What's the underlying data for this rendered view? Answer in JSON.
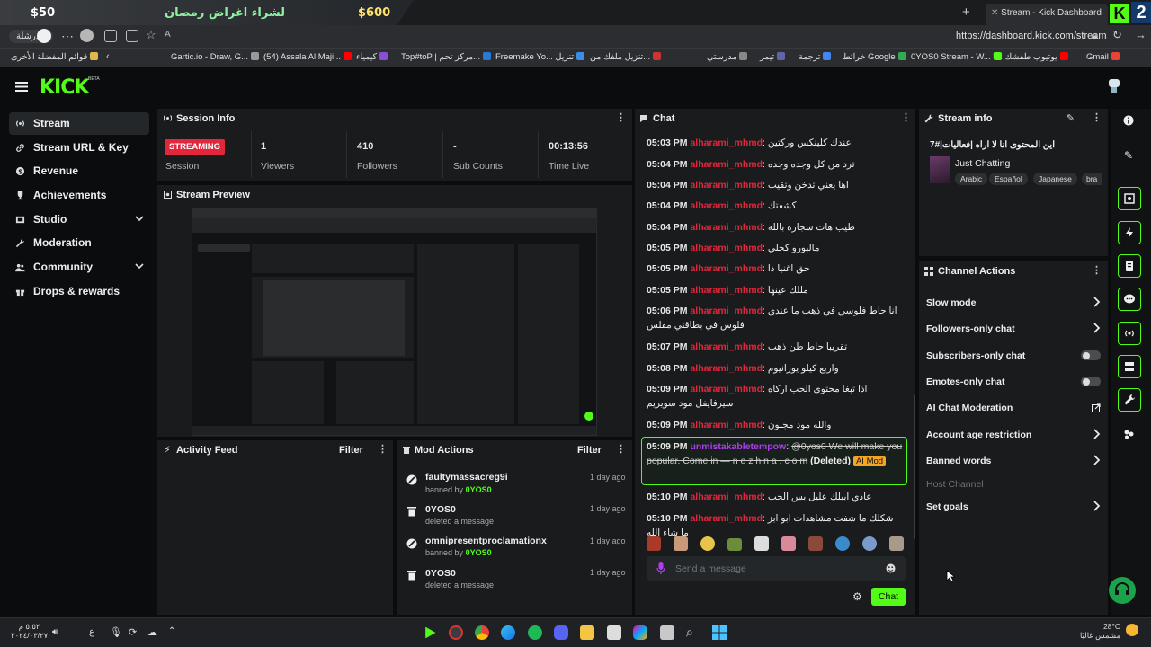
{
  "browser": {
    "promo_price_left": "$50",
    "promo_text": "لشراء اغراض رمضان",
    "promo_price_right": "$600",
    "tab_title": "Stream - Kick Dashboard",
    "new_tab": "+",
    "read_mode": "الدرشلة",
    "url": "https://dashboard.kick.com/stream",
    "brand_k2": "2",
    "bookmarks": [
      "Gmail",
      "يوتيوب طفشك هنا",
      "0YOS0 Stream - W...",
      "خرائط Google",
      "ترجمة",
      "تيمز",
      "مدرستي",
      "تنزيل ملفك من...",
      "Freemake Yo... تنزيل",
      "Top#toP | مركز تحم...",
      "كيمياء",
      "(54) Assala Al Maji...",
      "Gartic.io - Draw, G...",
      "قوائم المفضلة الأخرى"
    ]
  },
  "app": {
    "logo": "KICK",
    "beta": "BETA",
    "nav": [
      {
        "label": "Stream",
        "icon": "broadcast-icon"
      },
      {
        "label": "Stream URL & Key",
        "icon": "link-icon"
      },
      {
        "label": "Revenue",
        "icon": "coins-icon"
      },
      {
        "label": "Achievements",
        "icon": "trophy-icon"
      },
      {
        "label": "Studio",
        "icon": "film-icon"
      },
      {
        "label": "Moderation",
        "icon": "wrench-icon"
      },
      {
        "label": "Community",
        "icon": "users-icon"
      },
      {
        "label": "Drops & rewards",
        "icon": "gift-icon"
      }
    ]
  },
  "session": {
    "title": "Session Info",
    "status_badge": "STREAMING",
    "status_label": "Session",
    "stats": [
      {
        "value": "1",
        "label": "Viewers"
      },
      {
        "value": "410",
        "label": "Followers"
      },
      {
        "value": "-",
        "label": "Sub Counts"
      },
      {
        "value": "00:13:56",
        "label": "Time Live"
      }
    ]
  },
  "preview": {
    "title": "Stream Preview"
  },
  "activity": {
    "title": "Activity Feed",
    "filter": "Filter"
  },
  "mod_actions": {
    "title": "Mod Actions",
    "filter": "Filter",
    "items": [
      {
        "name": "faultymassacreg9i",
        "action": "banned by",
        "by": "0YOS0",
        "time": "1 day ago",
        "icon": "ban-icon"
      },
      {
        "name": "0YOS0",
        "action": "deleted a message",
        "by": "",
        "time": "1 day ago",
        "icon": "trash-icon"
      },
      {
        "name": "omnipresentproclamationx",
        "action": "banned by",
        "by": "0YOS0",
        "time": "1 day ago",
        "icon": "ban-icon"
      },
      {
        "name": "0YOS0",
        "action": "deleted a message",
        "by": "",
        "time": "1 day ago",
        "icon": "trash-icon"
      }
    ]
  },
  "chat": {
    "title": "Chat",
    "messages": [
      {
        "time": "05:03 PM",
        "user": "alharami_mhmd",
        "text": "عندك كلينكس وركتين"
      },
      {
        "time": "05:04 PM",
        "user": "alharami_mhmd",
        "text": "ترد من كل وجده وجده"
      },
      {
        "time": "05:04 PM",
        "user": "alharami_mhmd",
        "text": "اها يعني تدخن وتقيب"
      },
      {
        "time": "05:04 PM",
        "user": "alharami_mhmd",
        "text": "كشفتك"
      },
      {
        "time": "05:04 PM",
        "user": "alharami_mhmd",
        "text": "طيب هات سجاره بالله"
      },
      {
        "time": "05:05 PM",
        "user": "alharami_mhmd",
        "text": "مالبورو كحلي"
      },
      {
        "time": "05:05 PM",
        "user": "alharami_mhmd",
        "text": "حق اغنيا ذا"
      },
      {
        "time": "05:05 PM",
        "user": "alharami_mhmd",
        "text": "مللك عينها"
      },
      {
        "time": "05:06 PM",
        "user": "alharami_mhmd",
        "text": "انا حاط فلوسي في ذهب ما عندي فلوس في بطاقتي مفلس"
      },
      {
        "time": "05:07 PM",
        "user": "alharami_mhmd",
        "text": "تقريبا حاط طن ذهب"
      },
      {
        "time": "05:08 PM",
        "user": "alharami_mhmd",
        "text": "واربع كيلو يورانيوم"
      },
      {
        "time": "05:09 PM",
        "user": "alharami_mhmd",
        "text": "اذا تبغا محتوى الحب اركاه سيرفايفل مود سويريم"
      },
      {
        "time": "05:09 PM",
        "user": "alharami_mhmd",
        "text": "والله مود مجنون"
      }
    ],
    "deleted_message": {
      "time": "05:09 PM",
      "user": "unmistakabletempow",
      "text": "@0yos0 We will make you popular. Come in — n e z h n a . c o m",
      "deleted_label": "(Deleted)",
      "badge": "AI Mod"
    },
    "messages_after": [
      {
        "time": "05:10 PM",
        "user": "alharami_mhmd",
        "text": "عادي ابيلك عليل بس الحب"
      },
      {
        "time": "05:10 PM",
        "user": "alharami_mhmd",
        "text": "شكلك ما شفت مشاهدات ابو ابز ما شاء الله"
      }
    ],
    "input_placeholder": "Send a message",
    "send_button": "Chat"
  },
  "stream_info": {
    "title": "Stream info",
    "stream_title": "اين المحتوى انا لا اراه |فعاليات|#7",
    "category": "Just Chatting",
    "tags": [
      "Arabic",
      "Español",
      "Japanese",
      "bra"
    ]
  },
  "channel_actions": {
    "title": "Channel Actions",
    "items": [
      {
        "label": "Slow mode",
        "control": "chevron"
      },
      {
        "label": "Followers-only chat",
        "control": "chevron"
      },
      {
        "label": "Subscribers-only chat",
        "control": "toggle"
      },
      {
        "label": "Emotes-only chat",
        "control": "toggle"
      },
      {
        "label": "AI Chat Moderation",
        "control": "external"
      },
      {
        "label": "Account age restriction",
        "control": "chevron"
      },
      {
        "label": "Banned words",
        "control": "chevron"
      },
      {
        "label": "Host Channel",
        "control": "disabled"
      },
      {
        "label": "Set goals",
        "control": "chevron"
      }
    ]
  },
  "taskbar": {
    "clock_time": "٥:٥٢ م",
    "clock_date": "٢٠٢٤/٠٣/٢٧",
    "lang": "ع",
    "weather_temp": "28°C",
    "weather_text": "مشمس غالبًا"
  },
  "colors": {
    "accent": "#53fc18",
    "danger": "#e2263c",
    "panel": "#191b1c",
    "background": "#0b0c0d"
  }
}
